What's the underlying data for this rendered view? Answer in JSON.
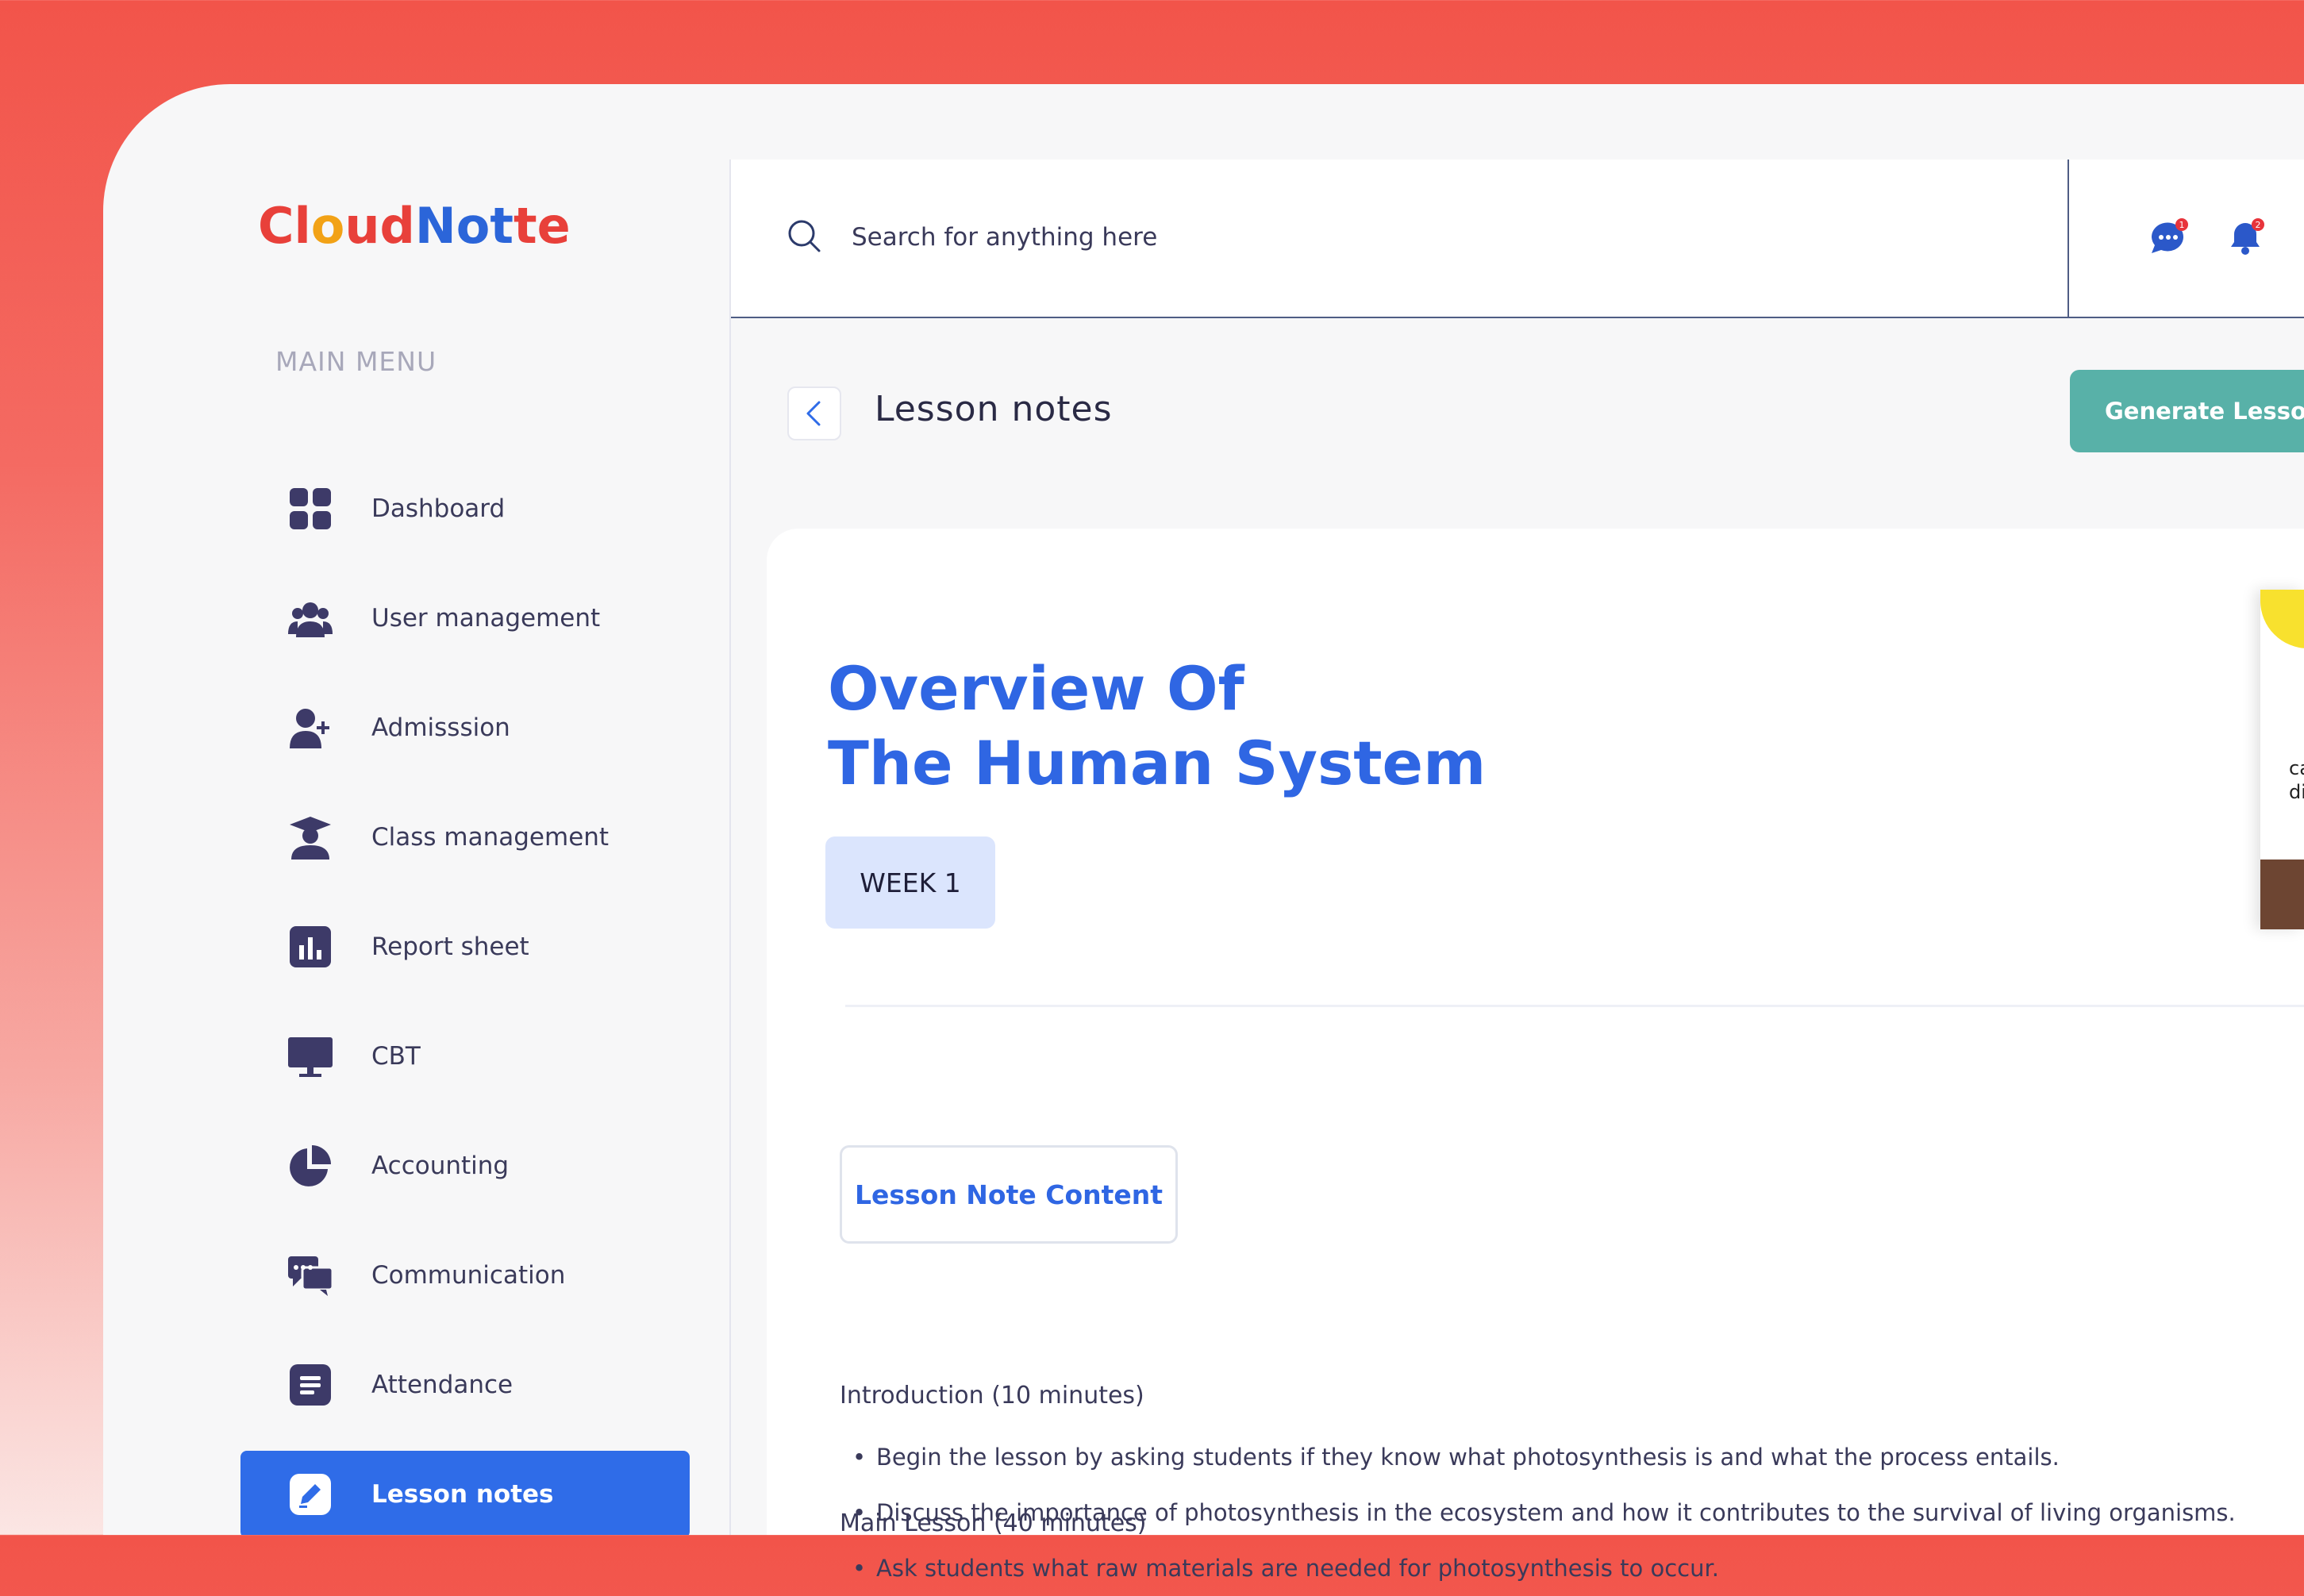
{
  "app": {
    "logo_parts": [
      "Cl",
      "o",
      "ud",
      "Not",
      "te"
    ]
  },
  "sidebar": {
    "heading": "MAIN MENU",
    "items": [
      {
        "label": "Dashboard",
        "icon": "grid-icon"
      },
      {
        "label": "User management",
        "icon": "users-icon"
      },
      {
        "label": "Admisssion",
        "icon": "user-plus-icon"
      },
      {
        "label": "Class management",
        "icon": "graduation-cap-icon"
      },
      {
        "label": "Report sheet",
        "icon": "bar-chart-icon"
      },
      {
        "label": "CBT",
        "icon": "monitor-icon"
      },
      {
        "label": "Accounting",
        "icon": "pie-chart-icon"
      },
      {
        "label": "Communication",
        "icon": "chat-icon"
      },
      {
        "label": "Attendance",
        "icon": "list-icon"
      },
      {
        "label": "Lesson notes",
        "icon": "edit-icon",
        "active": true
      }
    ]
  },
  "header": {
    "search_placeholder": "Search for anything here",
    "messages_badge": "1",
    "notifications_badge": "2"
  },
  "page": {
    "title": "Lesson notes",
    "generate_button": "Generate Lesson N"
  },
  "lesson": {
    "title_line1": "Overview Of",
    "title_line2": "The Human System",
    "week": "WEEK 1",
    "tab_label": "Lesson Note Content",
    "intro_heading": "Introduction (10 minutes)",
    "intro_points": [
      "Begin the lesson by asking students if they know what photosynthesis is and what the process entails.",
      "Discuss the importance of photosynthesis in the ecosystem and how it contributes to the survival of living organisms.",
      "Ask students what raw materials are needed for photosynthesis to occur."
    ],
    "next_heading": "Main Lesson (40 minutes)"
  },
  "side_card": {
    "text_line1": "ca",
    "text_line2": "di"
  },
  "colors": {
    "accent": "#2f6ce8",
    "title_blue": "#2f66e3",
    "teal": "#58b1a8",
    "icon": "#3d3a68",
    "badge_red": "#e8343b"
  }
}
